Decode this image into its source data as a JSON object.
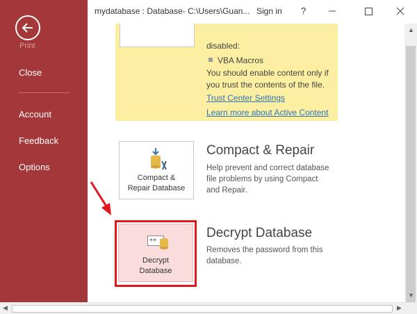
{
  "window": {
    "title": "mydatabase : Database- C:\\Users\\Guan...",
    "sign_in": "Sign in",
    "help": "?"
  },
  "backstage": {
    "print_label": "Print",
    "items": [
      {
        "label": "Close"
      },
      {
        "label": "Account"
      },
      {
        "label": "Feedback"
      },
      {
        "label": "Options"
      }
    ]
  },
  "security_warning": {
    "line_disabled": "disabled:",
    "bullet_item": "VBA Macros",
    "line_enable_1": "You should enable content only if",
    "line_enable_2": "you trust the contents of the file.",
    "link_trust": "Trust Center Settings",
    "link_learn": "Learn more about Active Content"
  },
  "compact": {
    "card_line1": "Compact &",
    "card_line2": "Repair Database",
    "title": "Compact & Repair",
    "desc_line1": "Help prevent and correct database",
    "desc_line2": "file problems by using Compact",
    "desc_line3": "and Repair."
  },
  "decrypt": {
    "card_line1": "Decrypt",
    "card_line2": "Database",
    "title": "Decrypt Database",
    "desc_line1": "Removes the password from this",
    "desc_line2": "database."
  },
  "colors": {
    "backstage": "#a4373a",
    "warning_bg": "#fcefa1",
    "link": "#2e75b6",
    "highlight": "#e3141c"
  }
}
